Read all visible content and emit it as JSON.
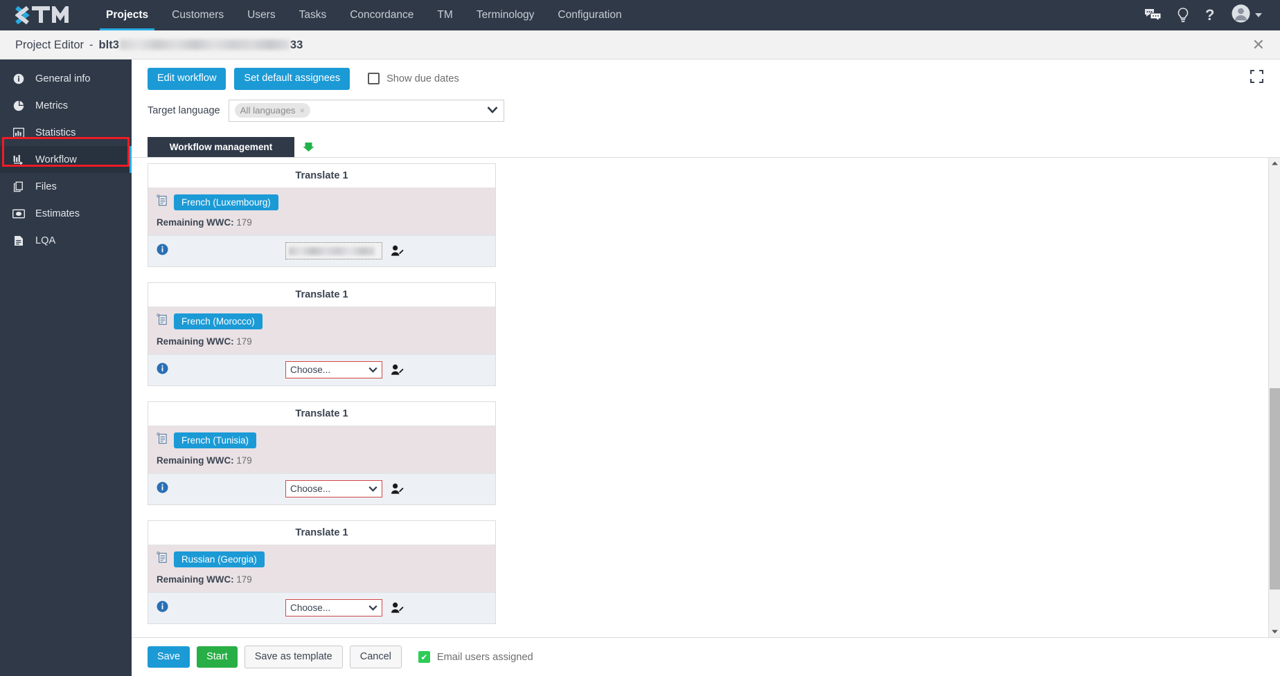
{
  "navbar": {
    "logo_text": "XTM",
    "items": [
      {
        "label": "Projects",
        "active": true
      },
      {
        "label": "Customers",
        "active": false
      },
      {
        "label": "Users",
        "active": false
      },
      {
        "label": "Tasks",
        "active": false
      },
      {
        "label": "Concordance",
        "active": false
      },
      {
        "label": "TM",
        "active": false
      },
      {
        "label": "Terminology",
        "active": false
      },
      {
        "label": "Configuration",
        "active": false
      }
    ],
    "icons": [
      "chat-icon",
      "lightbulb-icon",
      "help-icon",
      "avatar-icon",
      "chevron-down-icon"
    ],
    "background_color": "#2f3948",
    "accent_color": "#29abe2"
  },
  "editor": {
    "title": "Project Editor",
    "separator": "-",
    "project_prefix": "blt3",
    "project_suffix": "33",
    "close_label": "✕"
  },
  "sidebar": {
    "items": [
      {
        "label": "General info",
        "icon": "info-circle-icon",
        "active": false
      },
      {
        "label": "Metrics",
        "icon": "pie-chart-icon",
        "active": false
      },
      {
        "label": "Statistics",
        "icon": "bar-chart-icon",
        "active": false
      },
      {
        "label": "Workflow",
        "icon": "workflow-icon",
        "active": true
      },
      {
        "label": "Files",
        "icon": "files-icon",
        "active": false
      },
      {
        "label": "Estimates",
        "icon": "estimates-icon",
        "active": false
      },
      {
        "label": "LQA",
        "icon": "document-icon",
        "active": false
      }
    ],
    "highlight_color": "#ee1c25"
  },
  "toolbar": {
    "edit_workflow_label": "Edit workflow",
    "set_default_assignees_label": "Set default assignees",
    "show_due_dates_label": "Show due dates",
    "show_due_dates_checked": false,
    "expand_icon": "expand-icon"
  },
  "target_language": {
    "label": "Target language",
    "chip_label": "All languages",
    "chip_remove": "×"
  },
  "tabs": {
    "workflow_management_label": "Workflow management",
    "arrow_icon": "green-down-arrow-icon",
    "arrow_color": "#21b34a"
  },
  "workflow_cards": [
    {
      "step_title": "Translate 1",
      "language": "French (Luxembourg)",
      "wwc_label": "Remaining WWC:",
      "wwc_value": "179",
      "assignee_state": "assigned",
      "assignee_value": "",
      "assignee_placeholder": ""
    },
    {
      "step_title": "Translate 1",
      "language": "French (Morocco)",
      "wwc_label": "Remaining WWC:",
      "wwc_value": "179",
      "assignee_state": "choose",
      "assignee_value": "Choose...",
      "assignee_placeholder": "Choose..."
    },
    {
      "step_title": "Translate 1",
      "language": "French (Tunisia)",
      "wwc_label": "Remaining WWC:",
      "wwc_value": "179",
      "assignee_state": "choose",
      "assignee_value": "Choose...",
      "assignee_placeholder": "Choose..."
    },
    {
      "step_title": "Translate 1",
      "language": "Russian (Georgia)",
      "wwc_label": "Remaining WWC:",
      "wwc_value": "179",
      "assignee_state": "choose",
      "assignee_value": "Choose...",
      "assignee_placeholder": "Choose..."
    }
  ],
  "bottom_bar": {
    "save_label": "Save",
    "start_label": "Start",
    "save_template_label": "Save as template",
    "cancel_label": "Cancel",
    "email_users_label": "Email users assigned",
    "email_users_checked": true,
    "check_glyph": "✔"
  },
  "colors": {
    "primary_blue": "#1b9ad6",
    "green": "#27ae45",
    "error_red": "#d24545",
    "card_lang_bg": "#e9e1e4",
    "card_assign_bg": "#edf1f5"
  }
}
